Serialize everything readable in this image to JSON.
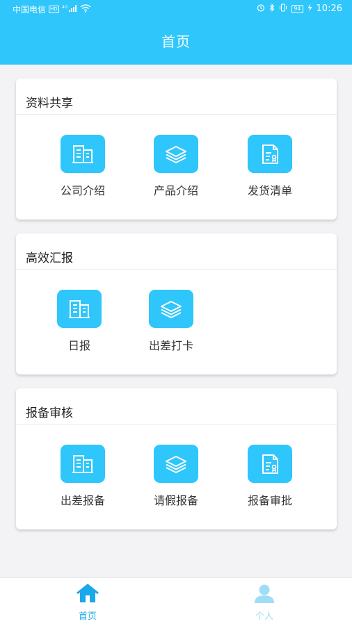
{
  "status_bar": {
    "carrier": "中国电信",
    "hd_label": "HD",
    "network": "4G",
    "battery": "94",
    "time": "10:26"
  },
  "header": {
    "title": "首页"
  },
  "sections": [
    {
      "title": "资料共享",
      "items": [
        {
          "label": "公司介绍",
          "icon": "building-icon"
        },
        {
          "label": "产品介绍",
          "icon": "layers-icon"
        },
        {
          "label": "发货清单",
          "icon": "certificate-document-icon"
        }
      ]
    },
    {
      "title": "高效汇报",
      "items": [
        {
          "label": "日报",
          "icon": "building-icon"
        },
        {
          "label": "出差打卡",
          "icon": "layers-icon"
        }
      ]
    },
    {
      "title": "报备审核",
      "items": [
        {
          "label": "出差报备",
          "icon": "building-icon"
        },
        {
          "label": "请假报备",
          "icon": "layers-icon"
        },
        {
          "label": "报备审批",
          "icon": "certificate-document-icon"
        }
      ]
    }
  ],
  "bottom_nav": [
    {
      "label": "首页",
      "icon": "home-icon",
      "active": true
    },
    {
      "label": "个人",
      "icon": "person-icon",
      "active": false
    }
  ],
  "colors": {
    "accent": "#2ec6fb",
    "nav_active": "#1aa8ea",
    "nav_inactive": "#9fdcf7",
    "background": "#f3f3f6"
  }
}
